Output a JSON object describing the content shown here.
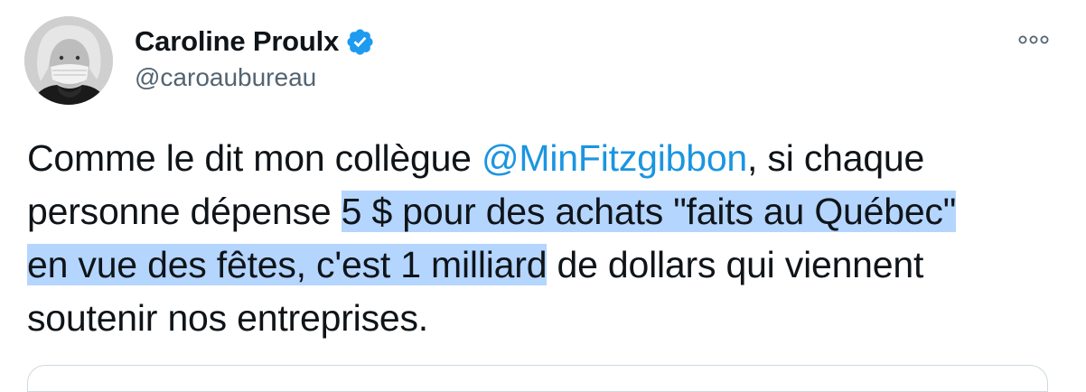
{
  "author": {
    "display_name": "Caroline Proulx",
    "handle": "@caroaubureau",
    "verified": true,
    "avatar_icon": "profile-photo"
  },
  "tweet": {
    "segments": [
      {
        "text": "Comme le dit mon collègue ",
        "kind": "text"
      },
      {
        "text": "@MinFitzgibbon",
        "kind": "mention"
      },
      {
        "text": ", si chaque\npersonne dépense ",
        "kind": "text"
      },
      {
        "text": "5 $ pour des achats \"faits au Québec\"\nen vue des fêtes, c'est 1 milliard",
        "kind": "highlighted"
      },
      {
        "text": " de dollars qui viennent\nsoutenir nos entreprises.",
        "kind": "text"
      }
    ]
  },
  "colors": {
    "mention": "#1b95e0",
    "verified_badge": "#1d9bf0",
    "selection_highlight": "#b4d5fe",
    "handle_text": "#536471"
  },
  "icons": {
    "verified": "verified-badge-icon",
    "more": "more-options-icon"
  }
}
